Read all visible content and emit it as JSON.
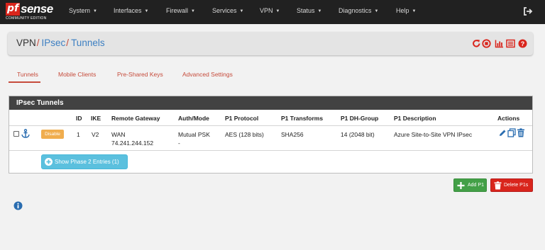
{
  "brand": {
    "logo_pf": "pf",
    "logo_sense": "sense",
    "edition": "COMMUNITY EDITION"
  },
  "nav": {
    "items": [
      "System",
      "Interfaces",
      "Firewall",
      "Services",
      "VPN",
      "Status",
      "Diagnostics",
      "Help"
    ],
    "logout_icon": "logout-icon"
  },
  "breadcrumb": {
    "items": [
      "VPN",
      "IPsec",
      "Tunnels"
    ],
    "separator": "/"
  },
  "header_icons": [
    "restart-icon",
    "stop-icon",
    "chart-icon",
    "list-icon",
    "help-icon"
  ],
  "tabs": [
    {
      "label": "Tunnels",
      "active": true
    },
    {
      "label": "Mobile Clients",
      "active": false
    },
    {
      "label": "Pre-Shared Keys",
      "active": false
    },
    {
      "label": "Advanced Settings",
      "active": false
    }
  ],
  "panel": {
    "title": "IPsec Tunnels",
    "columns": [
      "ID",
      "IKE",
      "Remote Gateway",
      "Auth/Mode",
      "P1 Protocol",
      "P1 Transforms",
      "P1 DH-Group",
      "P1 Description",
      "Actions"
    ],
    "rows": [
      {
        "disable_label": "Disable",
        "id": "1",
        "ike": "V2",
        "gateway_iface": "WAN",
        "gateway_ip": "74.241.244.152",
        "auth_mode": "Mutual PSK",
        "auth_extra": "-",
        "protocol": "AES (128 bits)",
        "transforms": "SHA256",
        "dh_group": "14 (2048 bit)",
        "description": "Azure Site-to-Site VPN IPsec"
      }
    ],
    "phase2_button": "Show Phase 2 Entries (1)"
  },
  "buttons": {
    "add": "Add P1",
    "delete": "Delete P1s"
  },
  "colors": {
    "navbar": "#212121",
    "accent_red": "#c64b3b",
    "link_blue": "#3c7fc2",
    "info": "#5bc0de",
    "success": "#43a047",
    "danger": "#d9251c",
    "warning": "#f0ad4e"
  }
}
